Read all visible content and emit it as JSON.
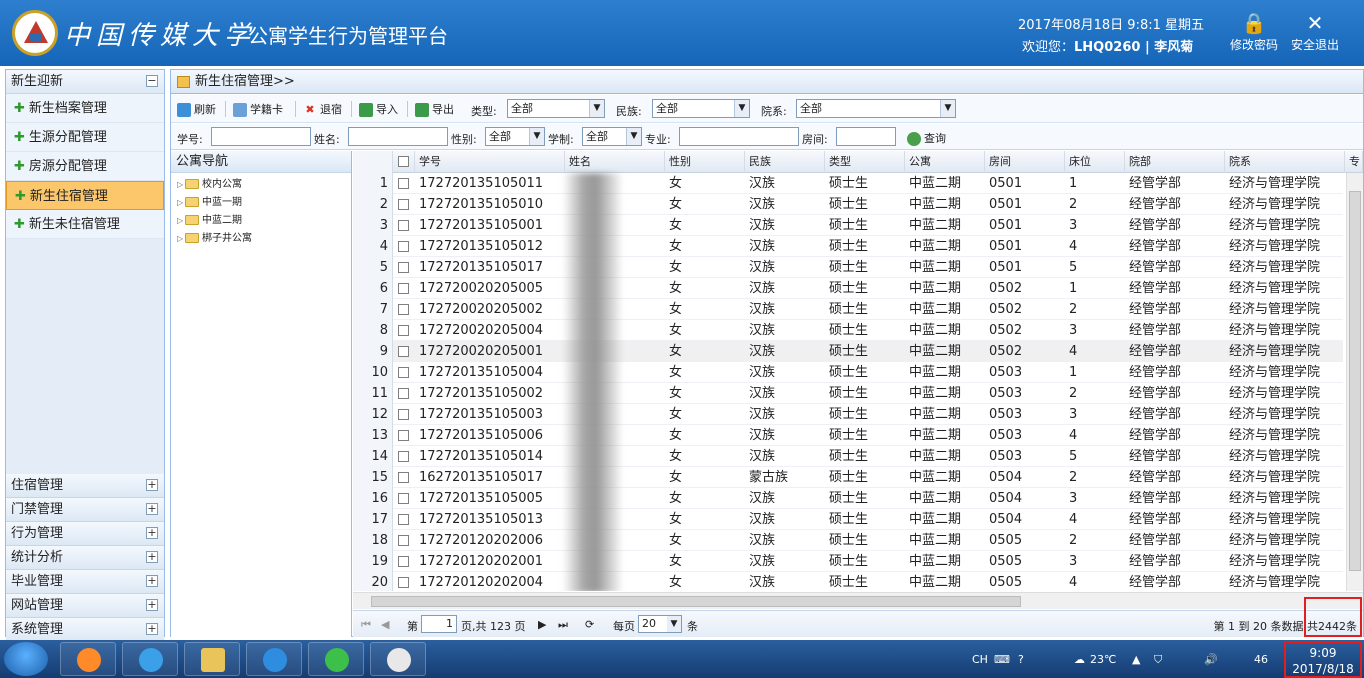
{
  "header": {
    "university": "中国传媒大学",
    "platform": "公寓学生行为管理平台",
    "datetime": "2017年08月18日 9:8:1 星期五",
    "welcome_prefix": "欢迎您：",
    "user": "LHQ0260 | 李风菊",
    "change_pwd": "修改密码",
    "logout": "安全退出"
  },
  "sidebar": {
    "top_section": "新生迎新",
    "items": [
      "新生档案管理",
      "生源分配管理",
      "房源分配管理",
      "新生住宿管理",
      "新生未住宿管理"
    ],
    "active_index": 3,
    "sections": [
      "住宿管理",
      "门禁管理",
      "行为管理",
      "统计分析",
      "毕业管理",
      "网站管理",
      "系统管理"
    ]
  },
  "panel": {
    "title": "新生住宿管理>>"
  },
  "toolbar": {
    "refresh": "刷新",
    "card": "学籍卡",
    "checkout": "退宿",
    "import": "导入",
    "export": "导出",
    "type_label": "类型:",
    "type_value": "全部",
    "nation_label": "民族:",
    "nation_value": "全部",
    "dept_label": "院系:",
    "dept_value": "全部"
  },
  "filters": {
    "id_label": "学号:",
    "name_label": "姓名:",
    "gender_label": "性别:",
    "gender_value": "全部",
    "system_label": "学制:",
    "system_value": "全部",
    "major_label": "专业:",
    "room_label": "房间:",
    "query": "查询"
  },
  "tree": {
    "title": "公寓导航",
    "nodes": [
      "校内公寓",
      "中蓝一期",
      "中蓝二期",
      "梆子井公寓"
    ]
  },
  "grid": {
    "columns": [
      "学号",
      "姓名",
      "性别",
      "民族",
      "类型",
      "公寓",
      "房间",
      "床位",
      "院部",
      "院系",
      "专"
    ],
    "rows": [
      [
        "172720135105011",
        "",
        "女",
        "汉族",
        "硕士生",
        "中蓝二期",
        "0501",
        "1",
        "经管学部",
        "经济与管理学院"
      ],
      [
        "172720135105010",
        "",
        "女",
        "汉族",
        "硕士生",
        "中蓝二期",
        "0501",
        "2",
        "经管学部",
        "经济与管理学院"
      ],
      [
        "172720135105001",
        "",
        "女",
        "汉族",
        "硕士生",
        "中蓝二期",
        "0501",
        "3",
        "经管学部",
        "经济与管理学院"
      ],
      [
        "172720135105012",
        "",
        "女",
        "汉族",
        "硕士生",
        "中蓝二期",
        "0501",
        "4",
        "经管学部",
        "经济与管理学院"
      ],
      [
        "172720135105017",
        "",
        "女",
        "汉族",
        "硕士生",
        "中蓝二期",
        "0501",
        "5",
        "经管学部",
        "经济与管理学院"
      ],
      [
        "172720020205005",
        "",
        "女",
        "汉族",
        "硕士生",
        "中蓝二期",
        "0502",
        "1",
        "经管学部",
        "经济与管理学院"
      ],
      [
        "172720020205002",
        "",
        "女",
        "汉族",
        "硕士生",
        "中蓝二期",
        "0502",
        "2",
        "经管学部",
        "经济与管理学院"
      ],
      [
        "172720020205004",
        "",
        "女",
        "汉族",
        "硕士生",
        "中蓝二期",
        "0502",
        "3",
        "经管学部",
        "经济与管理学院"
      ],
      [
        "172720020205001",
        "",
        "女",
        "汉族",
        "硕士生",
        "中蓝二期",
        "0502",
        "4",
        "经管学部",
        "经济与管理学院"
      ],
      [
        "172720135105004",
        "",
        "女",
        "汉族",
        "硕士生",
        "中蓝二期",
        "0503",
        "1",
        "经管学部",
        "经济与管理学院"
      ],
      [
        "172720135105002",
        "",
        "女",
        "汉族",
        "硕士生",
        "中蓝二期",
        "0503",
        "2",
        "经管学部",
        "经济与管理学院"
      ],
      [
        "172720135105003",
        "",
        "女",
        "汉族",
        "硕士生",
        "中蓝二期",
        "0503",
        "3",
        "经管学部",
        "经济与管理学院"
      ],
      [
        "172720135105006",
        "",
        "女",
        "汉族",
        "硕士生",
        "中蓝二期",
        "0503",
        "4",
        "经管学部",
        "经济与管理学院"
      ],
      [
        "172720135105014",
        "",
        "女",
        "汉族",
        "硕士生",
        "中蓝二期",
        "0503",
        "5",
        "经管学部",
        "经济与管理学院"
      ],
      [
        "162720135105017",
        "",
        "女",
        "蒙古族",
        "硕士生",
        "中蓝二期",
        "0504",
        "2",
        "经管学部",
        "经济与管理学院"
      ],
      [
        "172720135105005",
        "",
        "女",
        "汉族",
        "硕士生",
        "中蓝二期",
        "0504",
        "3",
        "经管学部",
        "经济与管理学院"
      ],
      [
        "172720135105013",
        "",
        "女",
        "汉族",
        "硕士生",
        "中蓝二期",
        "0504",
        "4",
        "经管学部",
        "经济与管理学院"
      ],
      [
        "172720120202006",
        "",
        "女",
        "汉族",
        "硕士生",
        "中蓝二期",
        "0505",
        "2",
        "经管学部",
        "经济与管理学院"
      ],
      [
        "172720120202001",
        "",
        "女",
        "汉族",
        "硕士生",
        "中蓝二期",
        "0505",
        "3",
        "经管学部",
        "经济与管理学院"
      ],
      [
        "172720120202004",
        "",
        "女",
        "汉族",
        "硕士生",
        "中蓝二期",
        "0505",
        "4",
        "经管学部",
        "经济与管理学院"
      ]
    ]
  },
  "pager": {
    "page_label": "第",
    "page": "1",
    "total_pages": "页,共 123 页",
    "per_page_label": "每页",
    "per_page": "20",
    "per_page_unit": "条",
    "summary": "第 1 到 20 条数据 共2442条"
  },
  "taskbar": {
    "lang": "CH",
    "temp": "23℃",
    "badge": "46",
    "time": "9:09",
    "date": "2017/8/18"
  },
  "colors": {
    "accent": "#1565b8",
    "active": "#fbc76a",
    "highlight": "#e02020"
  }
}
